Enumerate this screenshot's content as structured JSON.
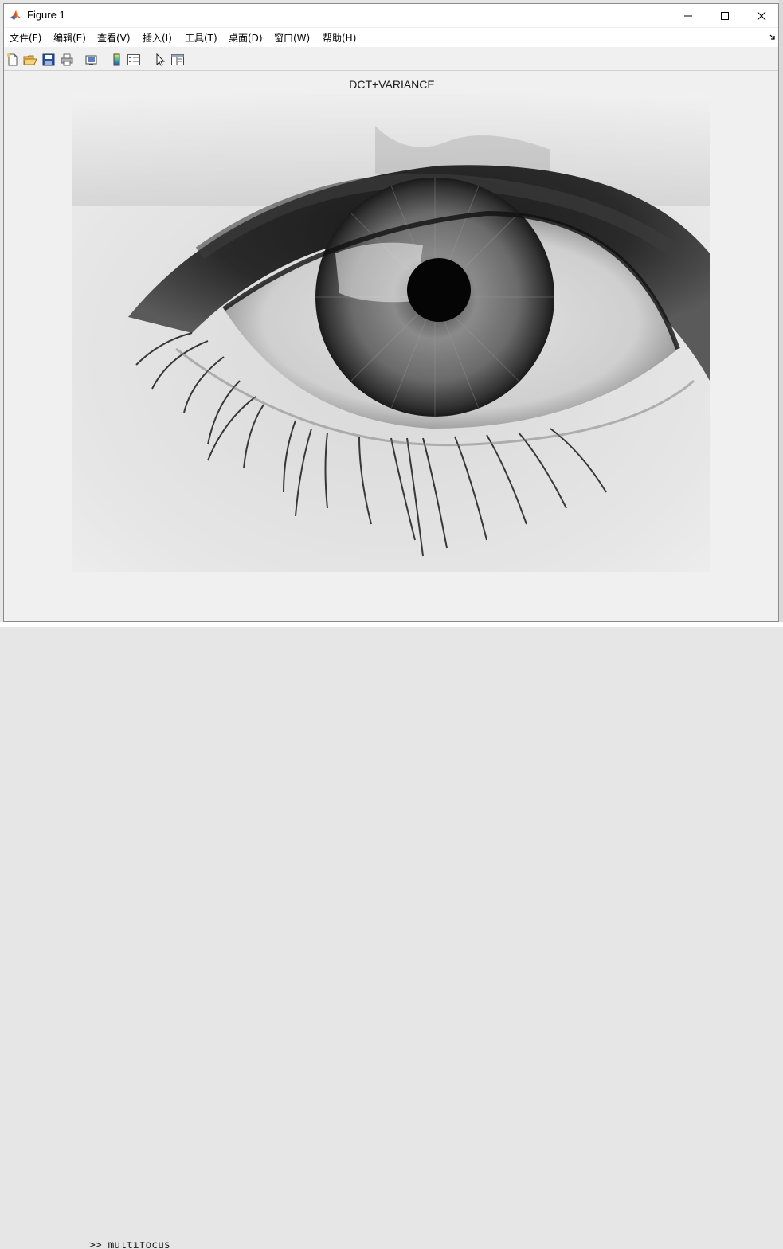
{
  "window": {
    "title": "Figure 1",
    "icon": "matlab-icon",
    "controls": [
      "minimize-icon",
      "maximize-icon",
      "close-icon"
    ]
  },
  "menu": {
    "items": [
      {
        "label": "文件(F)"
      },
      {
        "label": "编辑(E)"
      },
      {
        "label": "查看(V)"
      },
      {
        "label": "插入(I)"
      },
      {
        "label": "工具(T)"
      },
      {
        "label": "桌面(D)"
      },
      {
        "label": "窗口(W)"
      },
      {
        "label": "帮助(H)"
      }
    ]
  },
  "toolbar": {
    "buttons": [
      "new-figure-icon",
      "open-file-icon",
      "save-icon",
      "print-icon",
      "link-plot-icon",
      "colorbar-icon",
      "legend-icon",
      "edit-plot-icon",
      "property-inspector-icon"
    ]
  },
  "figure": {
    "title": "DCT+VARIANCE",
    "image_description": "grayscale image"
  },
  "background": {
    "command_text": ">> multifocus"
  }
}
